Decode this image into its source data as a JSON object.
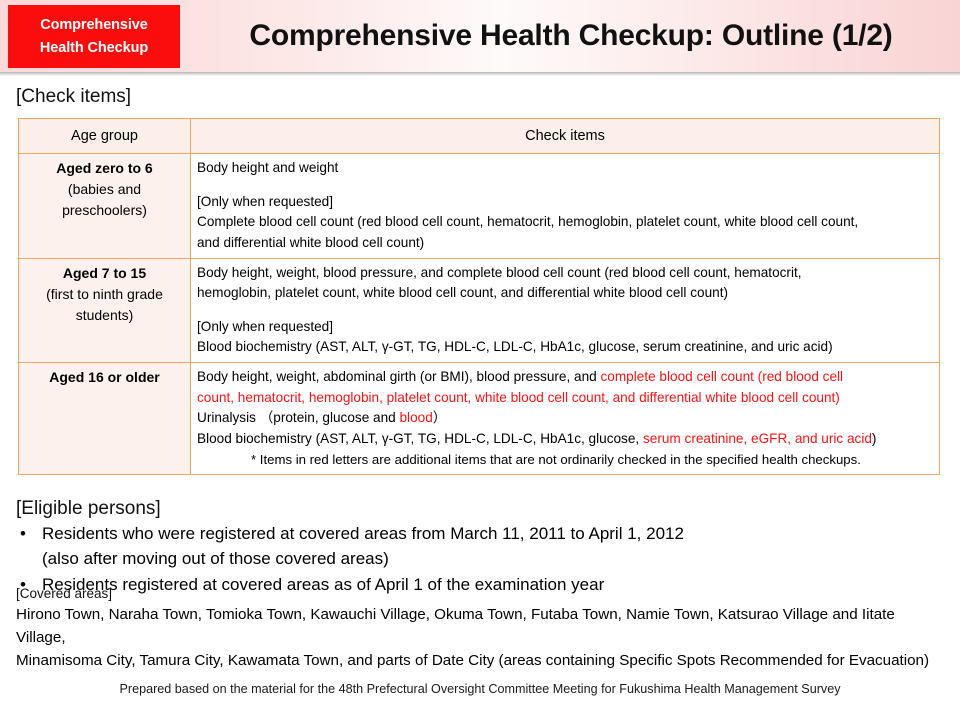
{
  "header": {
    "badge_line1": "Comprehensive",
    "badge_line2": "Health Checkup",
    "title": "Comprehensive Health Checkup: Outline (1/2)",
    "badge_color": "#fc0d0d",
    "banner_color": "#fbdede"
  },
  "sections": {
    "check_items_label": "[Check items]",
    "eligible_label": "[Eligible persons]",
    "covered_label": "[Covered areas]"
  },
  "table": {
    "headers": {
      "age_group": "Age group",
      "check_items": "Check items"
    },
    "rows": [
      {
        "age_main": "Aged zero to 6",
        "age_sub_1": "(babies and",
        "age_sub_2": "preschoolers)",
        "line_1": "Body height and weight",
        "line_2": "[Only when requested]",
        "line_3a": "Complete blood cell count (red blood cell count, hematocrit, hemoglobin, platelet count, white blood cell count,",
        "line_3b": "and differential white blood cell count)"
      },
      {
        "age_main": "Aged 7 to 15",
        "age_sub_1": "(first to ninth grade",
        "age_sub_2": "students)",
        "line_1a": "Body height, weight, blood pressure, and complete blood cell count (red blood cell count, hematocrit,",
        "line_1b": "hemoglobin, platelet count, white blood cell count, and differential white blood cell count)",
        "line_2": "[Only when requested]",
        "line_3": "Blood biochemistry (AST, ALT, γ-GT, TG, HDL-C, LDL-C, HbA1c, glucose, serum creatinine, and uric acid)"
      },
      {
        "age_main": "Aged 16 or older",
        "line_1_black": "Body height, weight, abdominal girth (or BMI), blood pressure, and ",
        "line_1_red": "complete blood cell count (red blood cell",
        "line_2_red": "count, hematocrit, hemoglobin, platelet count, white blood cell count, and differential white blood cell count)",
        "line_3_black_a": "Urinalysis （protein, glucose and ",
        "line_3_red": "blood",
        "line_3_black_b": "）",
        "line_4_black_a": "Blood biochemistry (AST, ALT, γ-GT, TG, HDL-C, LDL-C, HbA1c, glucose, ",
        "line_4_red": "serum creatinine, eGFR, and uric acid",
        "line_4_black_b": ")",
        "note": "* Items in red letters are additional items that are not ordinarily checked in the specified health checkups."
      }
    ]
  },
  "eligible_persons": {
    "bullet": "•",
    "items": [
      {
        "main": "Residents who were registered at covered areas from March 11, 2011 to April 1, 2012",
        "sub": "(also after moving out of those covered areas)"
      },
      {
        "main": "Residents registered at covered areas as of April 1 of the examination year",
        "sub": ""
      }
    ]
  },
  "covered_areas": {
    "line_1": "Hirono Town, Naraha Town, Tomioka Town, Kawauchi Village, Okuma Town, Futaba Town, Namie Town, Katsurao Village and Iitate Village,",
    "line_2": "Minamisoma City, Tamura City, Kawamata Town, and parts of Date City (areas containing Specific Spots Recommended for Evacuation)"
  },
  "footer": {
    "text": "Prepared based on the material for the 48th Prefectural Oversight Committee Meeting for Fukushima Health Management Survey"
  }
}
